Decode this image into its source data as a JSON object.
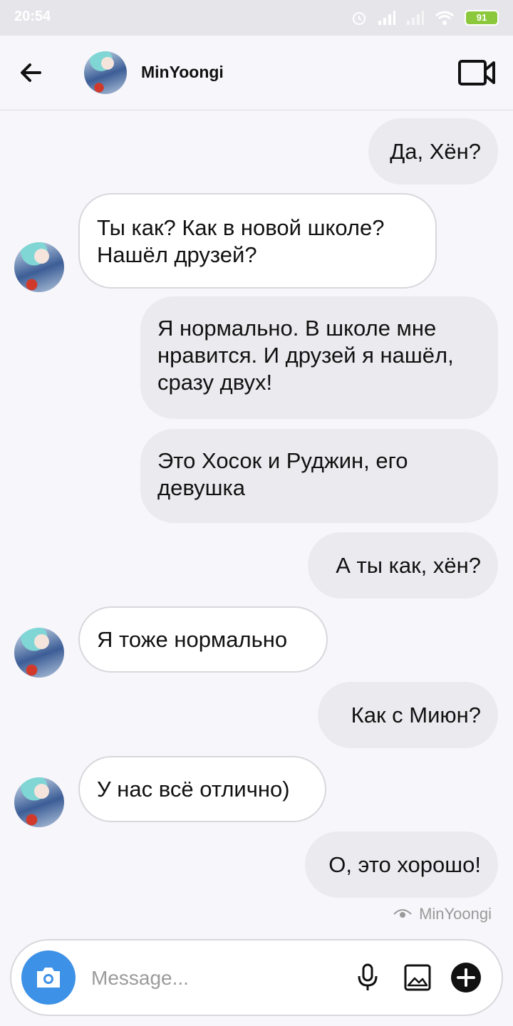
{
  "status": {
    "time": "20:54",
    "battery": "91"
  },
  "header": {
    "contact_name": "MinYoongi"
  },
  "messages": [
    {
      "direction": "out",
      "text": "Да, Хён?"
    },
    {
      "direction": "in",
      "text": "Ты как? Как в новой школе? Нашёл друзей?"
    },
    {
      "direction": "out",
      "text": "Я нормально. В школе мне нравится. И друзей я нашёл, сразу двух!"
    },
    {
      "direction": "out",
      "text": "Это Хосок и Руджин, его девушка"
    },
    {
      "direction": "out",
      "text": "А ты как, хён?"
    },
    {
      "direction": "in",
      "text": "Я тоже нормально"
    },
    {
      "direction": "out",
      "text": "Как с Миюн?"
    },
    {
      "direction": "in",
      "text": "У нас всё отлично)"
    },
    {
      "direction": "out",
      "text": "О, это хорошо!"
    }
  ],
  "seen_by": "MinYoongi",
  "composer": {
    "placeholder": "Message..."
  },
  "colors": {
    "accent": "#3d91e6",
    "outgoing_bubble": "#ebeaee",
    "incoming_bubble": "#ffffff",
    "battery": "#8cc83c"
  },
  "icons": [
    "back-arrow-icon",
    "video-call-icon",
    "camera-icon",
    "microphone-icon",
    "gallery-icon",
    "plus-circle-icon",
    "eye-icon"
  ]
}
